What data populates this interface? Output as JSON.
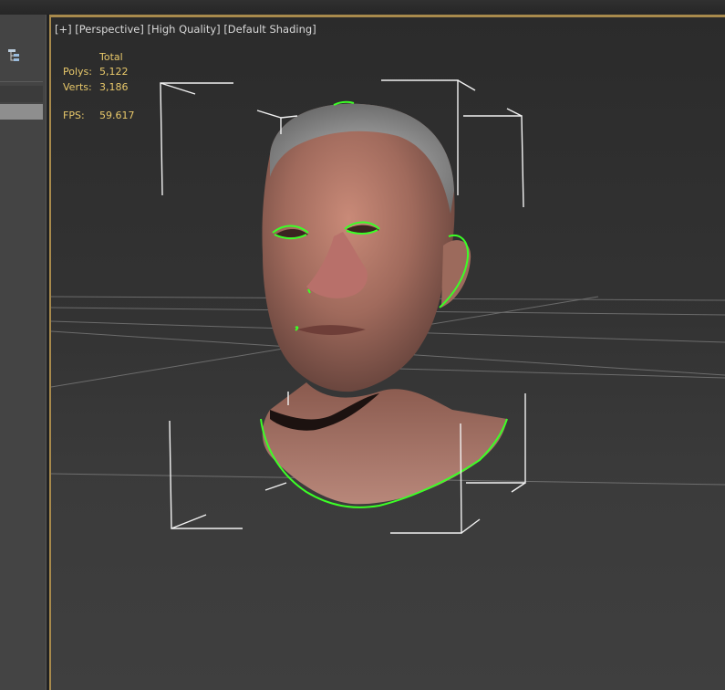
{
  "viewport": {
    "label_parts": [
      "[+]",
      "[Perspective]",
      "[High Quality]",
      "[Default Shading]"
    ],
    "stats": {
      "header": "Total",
      "polys_label": "Polys:",
      "polys_value": "5,122",
      "verts_label": "Verts:",
      "verts_value": "3,186",
      "fps_label": "FPS:",
      "fps_value": "59.617"
    }
  },
  "left_panel": {
    "hierarchy_icon": "hierarchy-icon"
  },
  "colors": {
    "stats_text": "#e8c86a",
    "gizmo_white": "#f2f2f2",
    "selection_green": "#3cff26",
    "accent_border": "#a88a4c"
  }
}
